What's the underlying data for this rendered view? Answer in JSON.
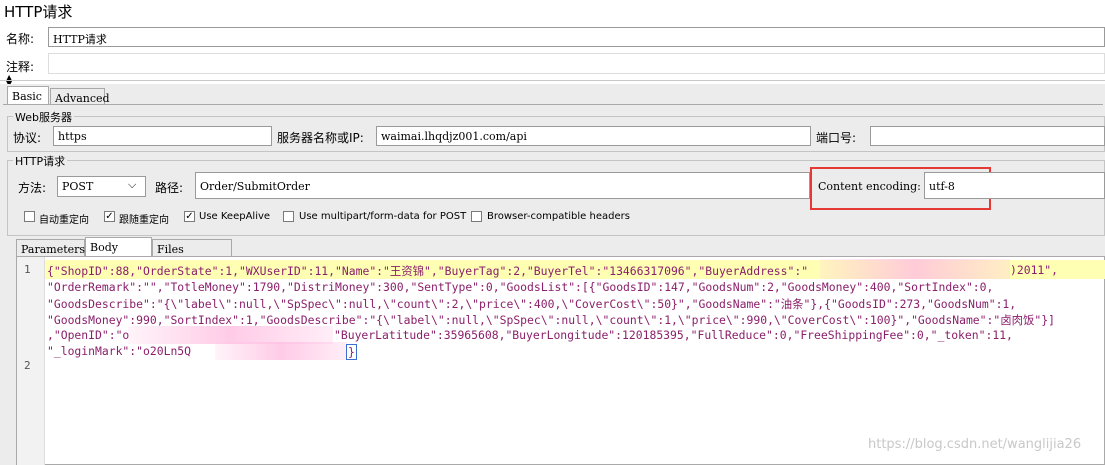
{
  "header": {
    "title": "HTTP请求",
    "name_label": "名称:",
    "name_value": "HTTP请求",
    "comment_label": "注释:"
  },
  "tabs": [
    {
      "label": "Basic",
      "selected": true
    },
    {
      "label": "Advanced",
      "selected": false
    }
  ],
  "web_server": {
    "group_title": "Web服务器",
    "protocol_label": "协议:",
    "protocol_value": "https",
    "server_label": "服务器名称或IP:",
    "server_value": "waimai.lhqdjz001.com/api",
    "port_label": "端口号:",
    "port_value": ""
  },
  "http_request": {
    "group_title": "HTTP请求",
    "method_label": "方法:",
    "method_value": "POST",
    "path_label": "路径:",
    "path_value": "Order/SubmitOrder",
    "encoding_label": "Content encoding:",
    "encoding_value": "utf-8"
  },
  "options": [
    {
      "label": "自动重定向",
      "checked": false
    },
    {
      "label": "跟随重定向",
      "checked": true
    },
    {
      "label": "Use KeepAlive",
      "checked": true
    },
    {
      "label": "Use multipart/form-data for POST",
      "checked": false
    },
    {
      "label": "Browser-compatible headers",
      "checked": false
    }
  ],
  "sub_tabs": [
    {
      "label": "Parameters"
    },
    {
      "label": "Body Data",
      "selected": true
    },
    {
      "label": "Files Upload"
    }
  ],
  "body": {
    "line_numbers": [
      "1",
      "2"
    ],
    "lines": [
      "{\"ShopID\":88,\"OrderState\":1,\"WXUserID\":11,\"Name\":\"王资锦\",\"BuyerTag\":2,\"BuyerTel\":\"13466317096\",\"BuyerAddress\":\"",
      "\"OrderRemark\":\"\",\"TotleMoney\":1790,\"DistriMoney\":300,\"SentType\":0,\"GoodsList\":[{\"GoodsID\":147,\"GoodsNum\":2,\"GoodsMoney\":400,\"SortIndex\":0,",
      "\"GoodsDescribe\":\"{\\\"label\\\":null,\\\"SpSpec\\\":null,\\\"count\\\":2,\\\"price\\\":400,\\\"CoverCost\\\":50}\",\"GoodsName\":\"油条\"},{\"GoodsID\":273,\"GoodsNum\":1,",
      "\"GoodsMoney\":990,\"SortIndex\":1,\"GoodsDescribe\":\"{\\\"label\\\":null,\\\"SpSpec\\\":null,\\\"count\\\":1,\\\"price\\\":990,\\\"CoverCost\\\":100}\",\"GoodsName\":\"卤肉饭\"}]",
      ",\"OpenID\":\"o",
      "\"_loginMark\":\"o20Ln5Q"
    ],
    "line1_tail": ")2011\",",
    "line5_tail": "\"BuyerLatitude\":35965608,\"BuyerLongitude\":120185395,\"FullReduce\":0,\"FreeShippingFee\":0,\"_token\":11,",
    "line6_tail": "}"
  },
  "watermark": "https://blog.csdn.net/wanglijia26"
}
